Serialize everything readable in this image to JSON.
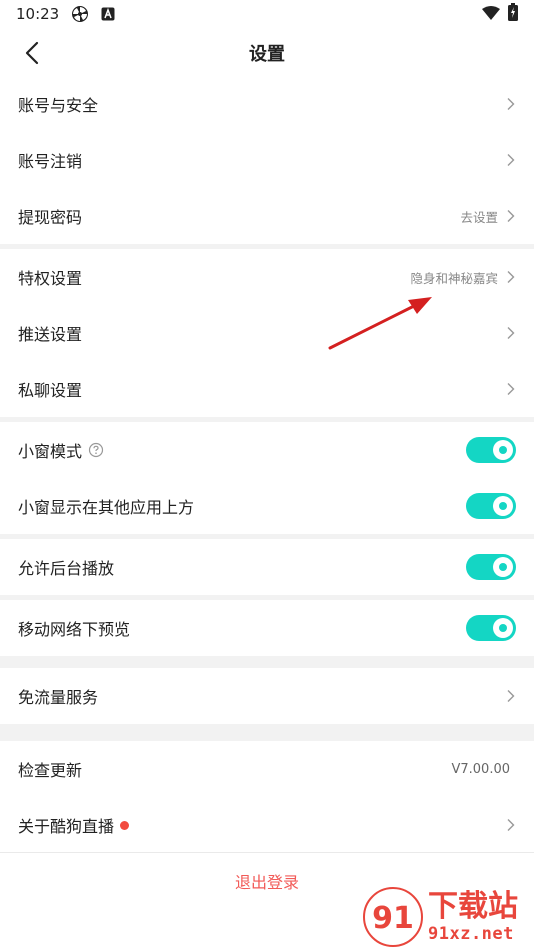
{
  "status_bar": {
    "time": "10:23",
    "icons": [
      "pinwheel-icon",
      "a-badge-icon",
      "wifi-icon",
      "battery-charging-icon"
    ]
  },
  "nav": {
    "title": "设置",
    "back_icon": "chevron-left-icon"
  },
  "sections": {
    "account": [
      {
        "label": "账号与安全",
        "value": ""
      },
      {
        "label": "账号注销",
        "value": ""
      },
      {
        "label": "提现密码",
        "value": "去设置"
      }
    ],
    "privacy": [
      {
        "label": "特权设置",
        "value": "隐身和神秘嘉宾"
      },
      {
        "label": "推送设置",
        "value": ""
      },
      {
        "label": "私聊设置",
        "value": ""
      }
    ],
    "window": [
      {
        "label": "小窗模式",
        "toggle": true
      },
      {
        "label": "小窗显示在其他应用上方",
        "toggle": true
      }
    ],
    "background": [
      {
        "label": "允许后台播放",
        "toggle": true
      }
    ],
    "network": [
      {
        "label": "移动网络下预览",
        "toggle": true
      }
    ],
    "data": [
      {
        "label": "免流量服务",
        "value": ""
      }
    ],
    "about": [
      {
        "label": "检查更新",
        "value": "V7.00.00"
      },
      {
        "label": "关于酷狗直播",
        "value": ""
      }
    ]
  },
  "logout_label": "退出登录",
  "watermark": {
    "logo_text": "91",
    "big_text": "下载站",
    "small_text": "91xz.net"
  },
  "colors": {
    "accent": "#14d6c4",
    "logout": "#f25b58",
    "badge": "#f24b3f",
    "annotation": "#d42020"
  }
}
